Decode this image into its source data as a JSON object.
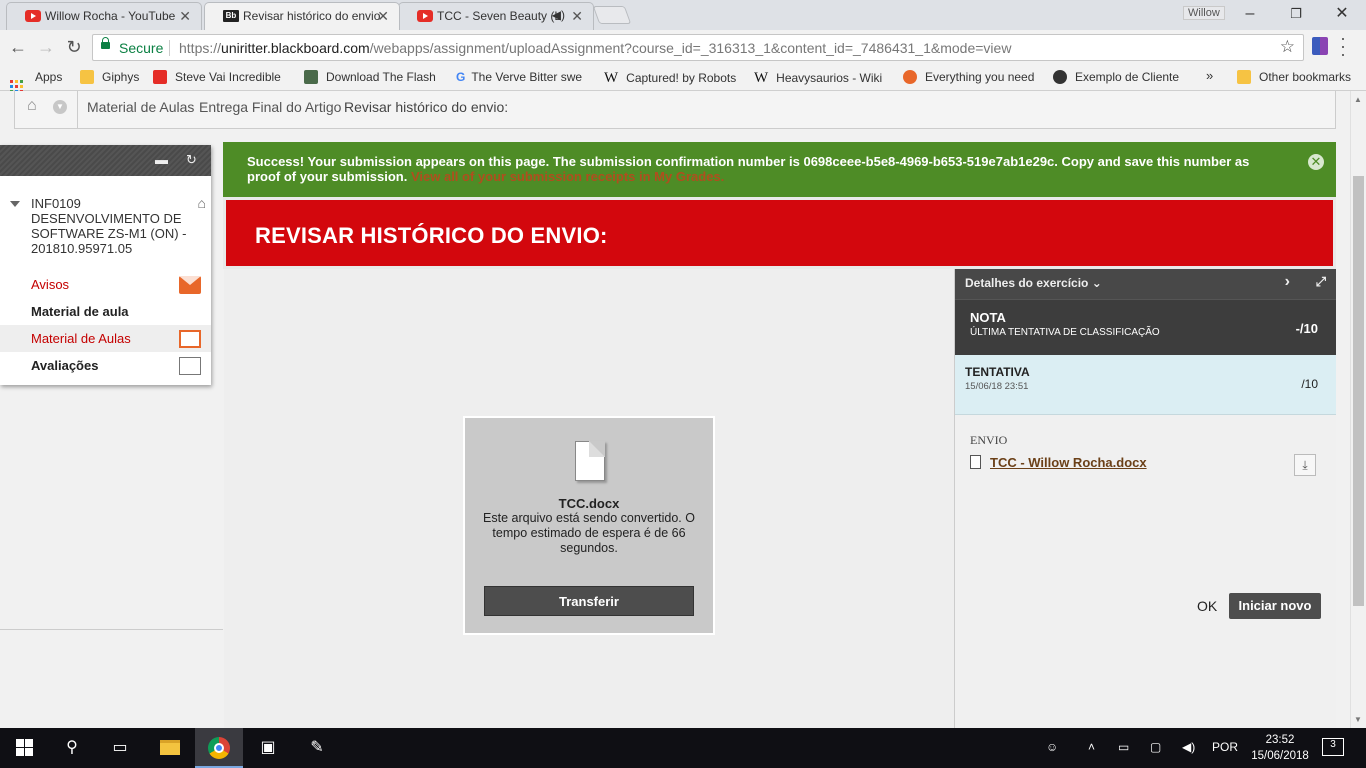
{
  "browser": {
    "tabs": [
      {
        "title": "Willow Rocha - YouTube",
        "icon": "youtube-icon"
      },
      {
        "title": "Revisar histórico do envio",
        "icon": "blackboard-icon"
      },
      {
        "title": "TCC - Seven Beauty (L",
        "icon": "youtube-icon"
      }
    ],
    "user": "Willow",
    "secure_label": "Secure",
    "url_scheme": "https://",
    "url_host": "uniritter.blackboard.com",
    "url_path": "/webapps/assignment/uploadAssignment?course_id=_316313_1&content_id=_7486431_1&mode=view",
    "bookmarks": {
      "apps": "Apps",
      "items": [
        "Giphys",
        "Steve Vai Incredible ",
        "Download The Flash",
        "The Verve Bitter swe",
        "Captured! by Robots",
        "Heavysaurios - Wiki",
        "Everything you need",
        "Exemplo de Cliente "
      ],
      "overflow": "»",
      "other": "Other bookmarks"
    }
  },
  "breadcrumb": {
    "items": [
      "Material de Aulas",
      "Entrega Final do Artigo"
    ],
    "current": "Revisar histórico do envio:"
  },
  "course_menu": {
    "course_title": "INF0109 DESENVOLVIMENTO DE SOFTWARE ZS-M1 (ON) - 201810.95971.05",
    "items": [
      {
        "label": "Avisos"
      },
      {
        "label": "Material de aula"
      },
      {
        "label": "Material de Aulas"
      },
      {
        "label": "Avaliações"
      }
    ]
  },
  "success": {
    "message": "Success! Your submission appears on this page. The submission confirmation number is 0698ceee-b5e8-4969-b653-519e7ab1e29c. Copy and save this number as proof of your submission.",
    "link": "View all of your submission receipts in My Grades."
  },
  "page_title": "REVISAR HISTÓRICO DO ENVIO:",
  "viewer": {
    "file_name": "TCC.docx",
    "message": "Este arquivo está sendo convertido. O tempo estimado de espera é de 66 segundos.",
    "transfer_label": "Transferir"
  },
  "details": {
    "header": "Detalhes do exercício",
    "grade_title": "NOTA",
    "grade_subtitle": "ÚLTIMA TENTATIVA DE CLASSIFICAÇÃO",
    "grade_score": "-/10",
    "attempt_title": "TENTATIVA",
    "attempt_date": "15/06/18 23:51",
    "attempt_score": "/10",
    "submission_label": "ENVIO",
    "submission_file": "TCC - Willow Rocha.docx",
    "ok_label": "OK",
    "new_label": "Iniciar novo"
  },
  "taskbar": {
    "language": "POR",
    "time": "23:52",
    "date": "15/06/2018",
    "notifications": "3"
  },
  "colors": {
    "header_red": "#d3070d",
    "success_green": "#4e8c26",
    "link_red": "#c40000"
  }
}
